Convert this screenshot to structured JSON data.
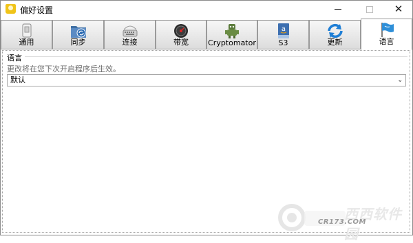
{
  "window": {
    "title": "偏好设置",
    "controls": {
      "minimize": "min",
      "maximize": "max",
      "close": "✕"
    }
  },
  "toolbar": {
    "tabs": [
      {
        "label": "通用",
        "icon": "switch-icon",
        "active": false
      },
      {
        "label": "同步",
        "icon": "sync-folder-icon",
        "active": false
      },
      {
        "label": "连接",
        "icon": "network-keyboard-icon",
        "active": false
      },
      {
        "label": "带宽",
        "icon": "gauge-icon",
        "active": false
      },
      {
        "label": "Cryptomator",
        "icon": "cryptomator-robot-icon",
        "active": false
      },
      {
        "label": "S3",
        "icon": "amazon-s3-icon",
        "active": false
      },
      {
        "label": "更新",
        "icon": "refresh-icon",
        "active": false
      },
      {
        "label": "语言",
        "icon": "flag-icon",
        "active": true
      }
    ]
  },
  "language_panel": {
    "group_label": "语言",
    "hint": "更改将在您下次开启程序后生效。",
    "select_value": "默认"
  },
  "watermark": {
    "name": "西西软件园",
    "site": "CR173.COM"
  },
  "colors": {
    "tab_gradient_top": "#f7f7f7",
    "tab_gradient_bottom": "#dcdcdc",
    "active_tab": "#ffffff",
    "border": "#9a9a9a",
    "hint_text": "#6d6d6d"
  }
}
